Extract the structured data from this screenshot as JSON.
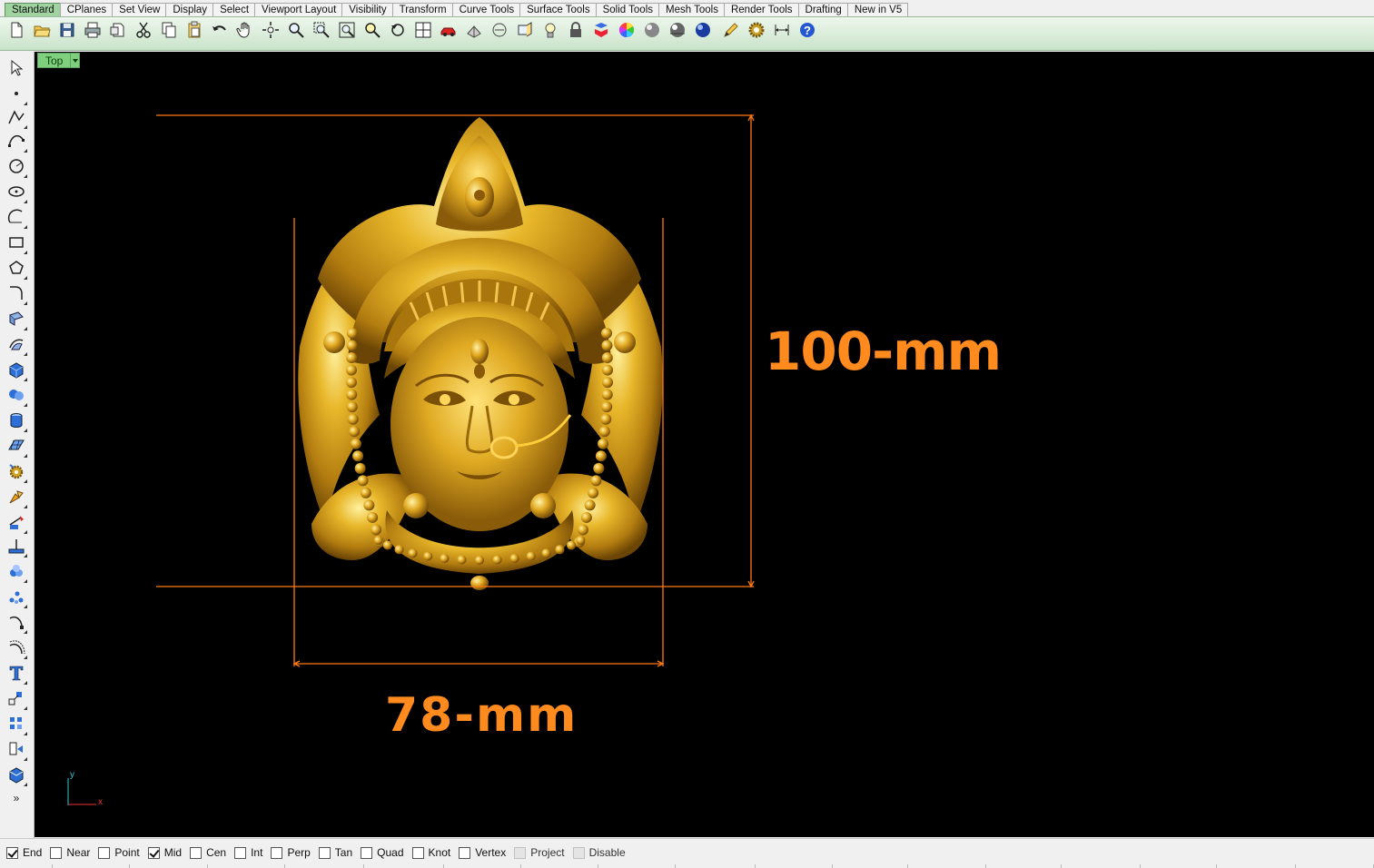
{
  "tabs": [
    {
      "label": "Standard",
      "active": true
    },
    {
      "label": "CPlanes"
    },
    {
      "label": "Set View"
    },
    {
      "label": "Display"
    },
    {
      "label": "Select"
    },
    {
      "label": "Viewport Layout"
    },
    {
      "label": "Visibility"
    },
    {
      "label": "Transform"
    },
    {
      "label": "Curve Tools"
    },
    {
      "label": "Surface Tools"
    },
    {
      "label": "Solid Tools"
    },
    {
      "label": "Mesh Tools"
    },
    {
      "label": "Render Tools"
    },
    {
      "label": "Drafting"
    },
    {
      "label": "New in V5"
    }
  ],
  "toolbar_icons": [
    "new-file-icon",
    "open-folder-icon",
    "save-icon",
    "print-icon",
    "import-icon",
    "cut-icon",
    "copy-icon",
    "paste-icon",
    "undo-icon",
    "pan-hand-icon",
    "rotate-view-icon",
    "zoom-icon",
    "zoom-window-icon",
    "zoom-extents-icon",
    "zoom-selected-icon",
    "undo-view-icon",
    "four-viewports-icon",
    "car-layer-icon",
    "object-properties-icon",
    "hide-icon",
    "show-icon",
    "light-bulb-icon",
    "lock-icon",
    "layer-material-icon",
    "color-wheel-icon",
    "shaded-sphere-icon",
    "rendered-sphere-icon",
    "render-blue-sphere-icon",
    "options-pencil-icon",
    "settings-gear-icon",
    "dimension-icon",
    "help-icon"
  ],
  "left_tools": [
    "select-arrow-icon",
    "point-icon",
    "polyline-icon",
    "curve-icon",
    "circle-icon",
    "ellipse-icon",
    "arc-icon",
    "rectangle-icon",
    "polygon-icon",
    "fillet-curve-icon",
    "surface-from-points-icon",
    "surface-extrude-icon",
    "box-solid-icon",
    "boolean-spheres-icon",
    "cylinder-icon",
    "mesh-plane-icon",
    "transform-gear-icon",
    "render-light-icon",
    "dimension-tool-icon",
    "ground-plane-icon",
    "analysis-icon",
    "scatter-points-icon",
    "curve-edit-icon",
    "curve-offset-icon",
    "text-icon",
    "scale-icon",
    "array-icon",
    "group-icon",
    "block-icon",
    "more-tools-icon"
  ],
  "viewport": {
    "title": "Top",
    "dimension_height_label": "100-mm",
    "dimension_width_label": "78-mm",
    "axis_y": "y",
    "axis_x": "x"
  },
  "osnaps": [
    {
      "label": "End",
      "checked": true
    },
    {
      "label": "Near",
      "checked": false
    },
    {
      "label": "Point",
      "checked": false
    },
    {
      "label": "Mid",
      "checked": true
    },
    {
      "label": "Cen",
      "checked": false
    },
    {
      "label": "Int",
      "checked": false
    },
    {
      "label": "Perp",
      "checked": false
    },
    {
      "label": "Tan",
      "checked": false
    },
    {
      "label": "Quad",
      "checked": false
    },
    {
      "label": "Knot",
      "checked": false
    },
    {
      "label": "Vertex",
      "checked": false
    },
    {
      "label": "Project",
      "checked": false,
      "disabled": true
    },
    {
      "label": "Disable",
      "checked": false,
      "disabled": true
    }
  ],
  "colors": {
    "tab_active": "#9fd39f",
    "viewport_title": "#7ed07e",
    "dimension": "#ff7a14",
    "sculpture_gold": "#d9a31c",
    "viewport_bg": "#000000"
  }
}
